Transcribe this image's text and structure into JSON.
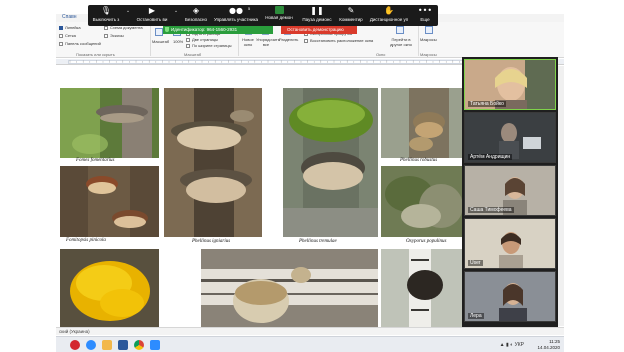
{
  "ribbon": {
    "active_tab": "Спавн",
    "options": [
      {
        "label": "Линейка",
        "checked": true
      },
      {
        "label": "Сетка",
        "checked": false
      },
      {
        "label": "Панель сообщений",
        "checked": false
      }
    ],
    "options2": [
      {
        "label": "Схема документа",
        "checked": false
      },
      {
        "label": "Эскизы",
        "checked": false
      }
    ],
    "zoom_label": "Масштаб",
    "zoom_pct": "100%",
    "one_page": "Одна страница",
    "two_pages": "Две страницы",
    "page_width": "По ширине страницы",
    "new_window": "Новое окно",
    "arrange_all": "Упорядочить все",
    "split": "Разделить",
    "side_by_side": "Рядом",
    "sync_scroll": "Синхронная прокрутка",
    "restore_pos": "Восстановить расположение окна",
    "switch_windows": "Перейти в другое окно",
    "macros": "Макросы",
    "group_show": "Показать или скрыть",
    "group_zoom": "Масштаб",
    "group_window": "Окно",
    "group_macros": "Макросы"
  },
  "zoom_toolbar": {
    "mute": "Выключить з",
    "stop_video": "Остановить ви",
    "security": "Безопасно",
    "participants": "Управлять участника",
    "participants_count": "5",
    "new_share": "Новая демон",
    "pause_share": "Пауза демонс",
    "annotate": "Комментир",
    "remote_control": "Дистанционное уп",
    "more": "Еще",
    "icons": [
      "microphone-icon",
      "video-camera-icon",
      "shield-icon",
      "participants-icon",
      "share-screen-icon",
      "pause-icon",
      "pen-icon",
      "remote-control-icon",
      "more-icon"
    ]
  },
  "share_bar": {
    "meeting_id": "Идентификатор: 964-1560-2931",
    "stop_share": "Остановить демонстрацию",
    "colors": {
      "id_bg": "#2a9d3c",
      "stop_bg": "#d93a2b"
    }
  },
  "document": {
    "captions": [
      "Fomes fomentarius",
      "Phellinus igniarius",
      "Phellinus tremulae",
      "Phellinus robustus",
      "Fomitopsis pinicola",
      "Oxyporus populinus"
    ]
  },
  "participants": [
    {
      "name": "Татьяна Бойко",
      "active": true
    },
    {
      "name": "Артём Андрищин",
      "active": false
    },
    {
      "name": "Саша Тимофеева",
      "active": false
    },
    {
      "name": "User",
      "active": false
    },
    {
      "name": "Лера",
      "active": false
    }
  ],
  "statusbar": {
    "language": "ский (Украина)"
  },
  "taskbar": {
    "time": "11:25",
    "date": "14.04.2020",
    "lang": "УКР",
    "apps": [
      "opera-icon",
      "zoom-icon",
      "explorer-icon",
      "word-icon",
      "chrome-icon",
      "zoom-meeting-icon"
    ]
  }
}
